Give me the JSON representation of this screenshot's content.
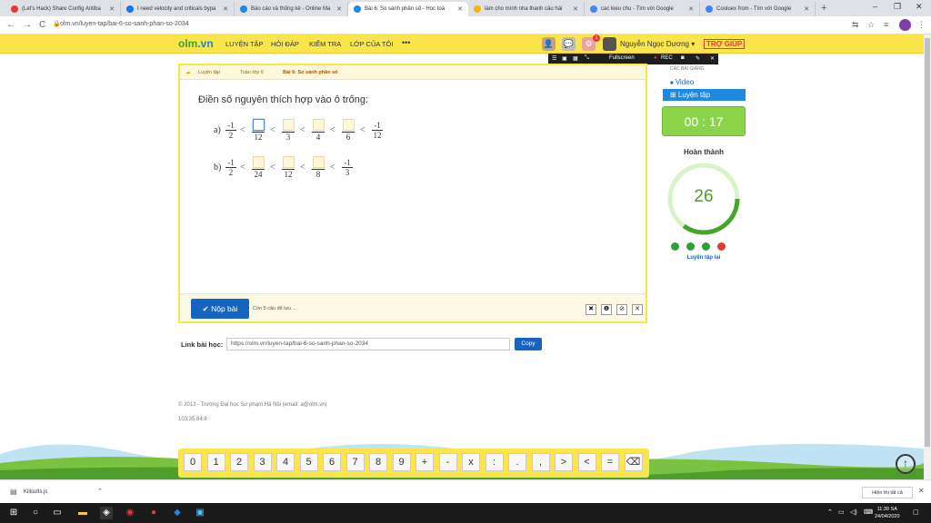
{
  "browser": {
    "tabs": [
      {
        "title": "(Let's Hack) Share Config Antiba",
        "color": "#e53935"
      },
      {
        "title": "I need velocity and criticals bypa",
        "color": "#1a73e8"
      },
      {
        "title": "Báo cáo và thống kê - Online Ma",
        "color": "#1e88e5"
      },
      {
        "title": "Bài 6: So sánh phân số - Học toá",
        "color": "#1e88e5"
      },
      {
        "title": "làm cho mình nha thanh câu hái",
        "color": "#f5b800"
      },
      {
        "title": "cac kieu chu - Tìm với Google",
        "color": "#4285f4"
      },
      {
        "title": "Cooluex from - Tìm với Google",
        "color": "#4285f4"
      }
    ],
    "new_tab": "+",
    "win_min": "–",
    "win_max": "❐",
    "win_close": "✕",
    "back": "←",
    "forward": "→",
    "reload": "C",
    "url": "olm.vn/luyen-tap/bai-6-so-sanh-phan-so-2034",
    "star": "☆"
  },
  "site": {
    "logo_main": "olm",
    "logo_domain": ".vn",
    "nav": [
      "LUYỆN TẬP",
      "HỎI ĐÁP",
      "KIỂM TRA",
      "LỚP CỦA TÔI"
    ],
    "more": "•••",
    "notif_count": "1",
    "user_name": "Nguyễn Ngọc Dương",
    "help": "TRỢ GIÚP"
  },
  "recorder": {
    "fullscreen": "Fullscreen",
    "rec": "REC"
  },
  "breadcrumb": [
    "Luyện tập",
    "Toán lớp 6",
    "Bài 6: So sánh phân số"
  ],
  "exercise": {
    "instruction": "Điền số nguyên thích hợp vào ô trống:",
    "row_a_label": "a)",
    "row_b_label": "b)",
    "row_a": {
      "first_num": "-1",
      "first_den": "2",
      "blank_dens": [
        "12",
        "3",
        "4",
        "6"
      ],
      "last_num": "-1",
      "last_den": "12"
    },
    "row_b": {
      "first_num": "-1",
      "first_den": "2",
      "blank_dens": [
        "24",
        "12",
        "8"
      ],
      "last_num": "-1",
      "last_den": "3"
    },
    "lt": "<",
    "submit": "✔ Nộp bài",
    "remaining": "Còn 5 câu để lưu ...",
    "footer_btns": [
      "✖",
      "❶",
      "⊘",
      "✕"
    ]
  },
  "link": {
    "label": "Link bài học:",
    "value": "https://olm.vn/luyen-tap/bai-6-so-sanh-phan-so-2034",
    "copy": "Copy"
  },
  "footer": {
    "copyright": "© 2013 - Trường Đại học Sư phạm Hà Nội (email: a@olm.vn)",
    "ip": "103.35.64.8"
  },
  "side": {
    "section_title": "CÁC BÀI GIẢNG",
    "video": "Video",
    "practice": "⊞ Luyện tập",
    "timer": "00 : 17",
    "done_label": "Hoàn thành",
    "score": "26",
    "score_progress": 0.35,
    "dots": [
      "#2e9e3a",
      "#2e9e3a",
      "#2e9e3a",
      "#e53935"
    ],
    "retry": "Luyện tập lại"
  },
  "keypad": [
    "0",
    "1",
    "2",
    "3",
    "4",
    "5",
    "6",
    "7",
    "8",
    "9",
    "+",
    "-",
    "x",
    ":",
    ".",
    ",",
    ">",
    "<",
    "=",
    "⌫"
  ],
  "downloads": {
    "file": "Killsults.js",
    "show_all": "Hiện thị tất cả",
    "close": "✕"
  },
  "taskbar": {
    "time": "11:39 SA",
    "date": "24/04/2020"
  }
}
